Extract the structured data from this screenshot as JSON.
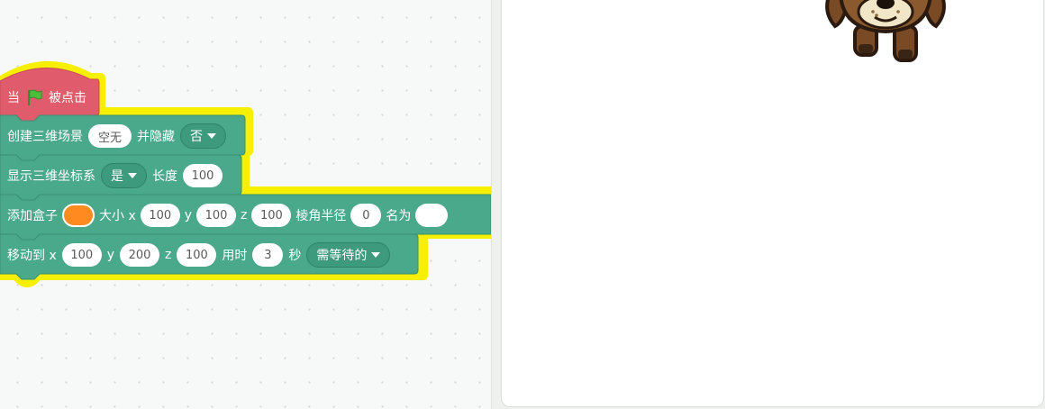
{
  "colors": {
    "hat_block": "#e05c6c",
    "stack_block": "#4aa98a",
    "selection_glow": "#f7ef00",
    "color_swatch": "#ff8a1f"
  },
  "blocks": {
    "hat": {
      "when": "当",
      "clicked": "被点击",
      "icon": "green-flag-icon"
    },
    "create_scene": {
      "label": "创建三维场景",
      "scene_value": "空无",
      "hide_label": "并隐藏",
      "hide_option": "否"
    },
    "show_axes": {
      "label": "显示三维坐标系",
      "option": "是",
      "length_label": "长度",
      "length_value": "100"
    },
    "add_box": {
      "label": "添加盒子",
      "size_label": "大小 x",
      "x_value": "100",
      "y_label": "y",
      "y_value": "100",
      "z_label": "z",
      "z_value": "100",
      "radius_label": "棱角半径",
      "radius_value": "0",
      "name_label": "名为",
      "name_value": ""
    },
    "move_to": {
      "label": "移动到 x",
      "x_value": "100",
      "y_label": "y",
      "y_value": "200",
      "z_label": "z",
      "z_value": "100",
      "time_label": "用时",
      "time_value": "3",
      "sec_label": "秒",
      "wait_option": "需等待的"
    }
  },
  "stage": {
    "sprite": "dog-sprite"
  }
}
